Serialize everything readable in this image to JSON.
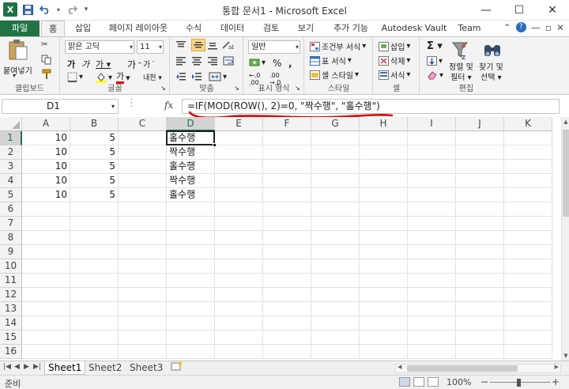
{
  "window": {
    "title": "통합 문서1 - Microsoft Excel",
    "minimize": "—",
    "maximize": "☐",
    "close": "✕"
  },
  "qat": {
    "logo": "X"
  },
  "tabs": [
    {
      "label": "파일",
      "kind": "file"
    },
    {
      "label": "홈",
      "kind": "active"
    },
    {
      "label": "삽입"
    },
    {
      "label": "페이지 레이아웃"
    },
    {
      "label": "수식"
    },
    {
      "label": "데이터"
    },
    {
      "label": "검토"
    },
    {
      "label": "보기"
    },
    {
      "label": "추가 기능"
    },
    {
      "label": "Autodesk Vault"
    },
    {
      "label": "Team"
    }
  ],
  "ribbon": {
    "clipboard": {
      "label": "클립보드",
      "paste": "붙여넣기"
    },
    "font": {
      "label": "글꼴",
      "font_name": "맑은 고딕",
      "font_size": "11"
    },
    "alignment": {
      "label": "맞춤"
    },
    "number": {
      "label": "표시 형식",
      "format": "일반"
    },
    "styles": {
      "label": "스타일",
      "conditional": "조건부 서식",
      "table": "표 서식",
      "cell_style": "셀 스타일"
    },
    "cells": {
      "label": "셀",
      "insert": "삽입",
      "delete": "삭제",
      "format": "서식"
    },
    "editing": {
      "label": "편집",
      "sort": "정렬 및",
      "filter": "필터",
      "find": "찾기 및",
      "select": "선택"
    }
  },
  "formula_bar": {
    "name_box": "D1",
    "fx": "fx",
    "formula": "=IF(MOD(ROW(), 2)=0, \"짝수행\", \"홀수행\")"
  },
  "sheet": {
    "columns": [
      "A",
      "B",
      "C",
      "D",
      "E",
      "F",
      "G",
      "H",
      "I",
      "J",
      "K"
    ],
    "selected_column": "D",
    "rows": [
      "1",
      "2",
      "3",
      "4",
      "5",
      "6",
      "7",
      "8",
      "9",
      "10",
      "11",
      "12",
      "13",
      "14",
      "15",
      "16"
    ],
    "selected_row": "1",
    "cells": [
      [
        "10",
        "5",
        "",
        "홀수행"
      ],
      [
        "10",
        "5",
        "",
        "짝수행"
      ],
      [
        "10",
        "5",
        "",
        "홀수행"
      ],
      [
        "10",
        "5",
        "",
        "짝수행"
      ],
      [
        "10",
        "5",
        "",
        "홀수행"
      ]
    ]
  },
  "sheet_tabs": [
    "Sheet1",
    "Sheet2",
    "Sheet3"
  ],
  "active_sheet": "Sheet1",
  "status": {
    "ready": "준비",
    "zoom": "100%"
  },
  "colors": {
    "excel_green": "#217346",
    "annotation_red": "#e00000"
  }
}
